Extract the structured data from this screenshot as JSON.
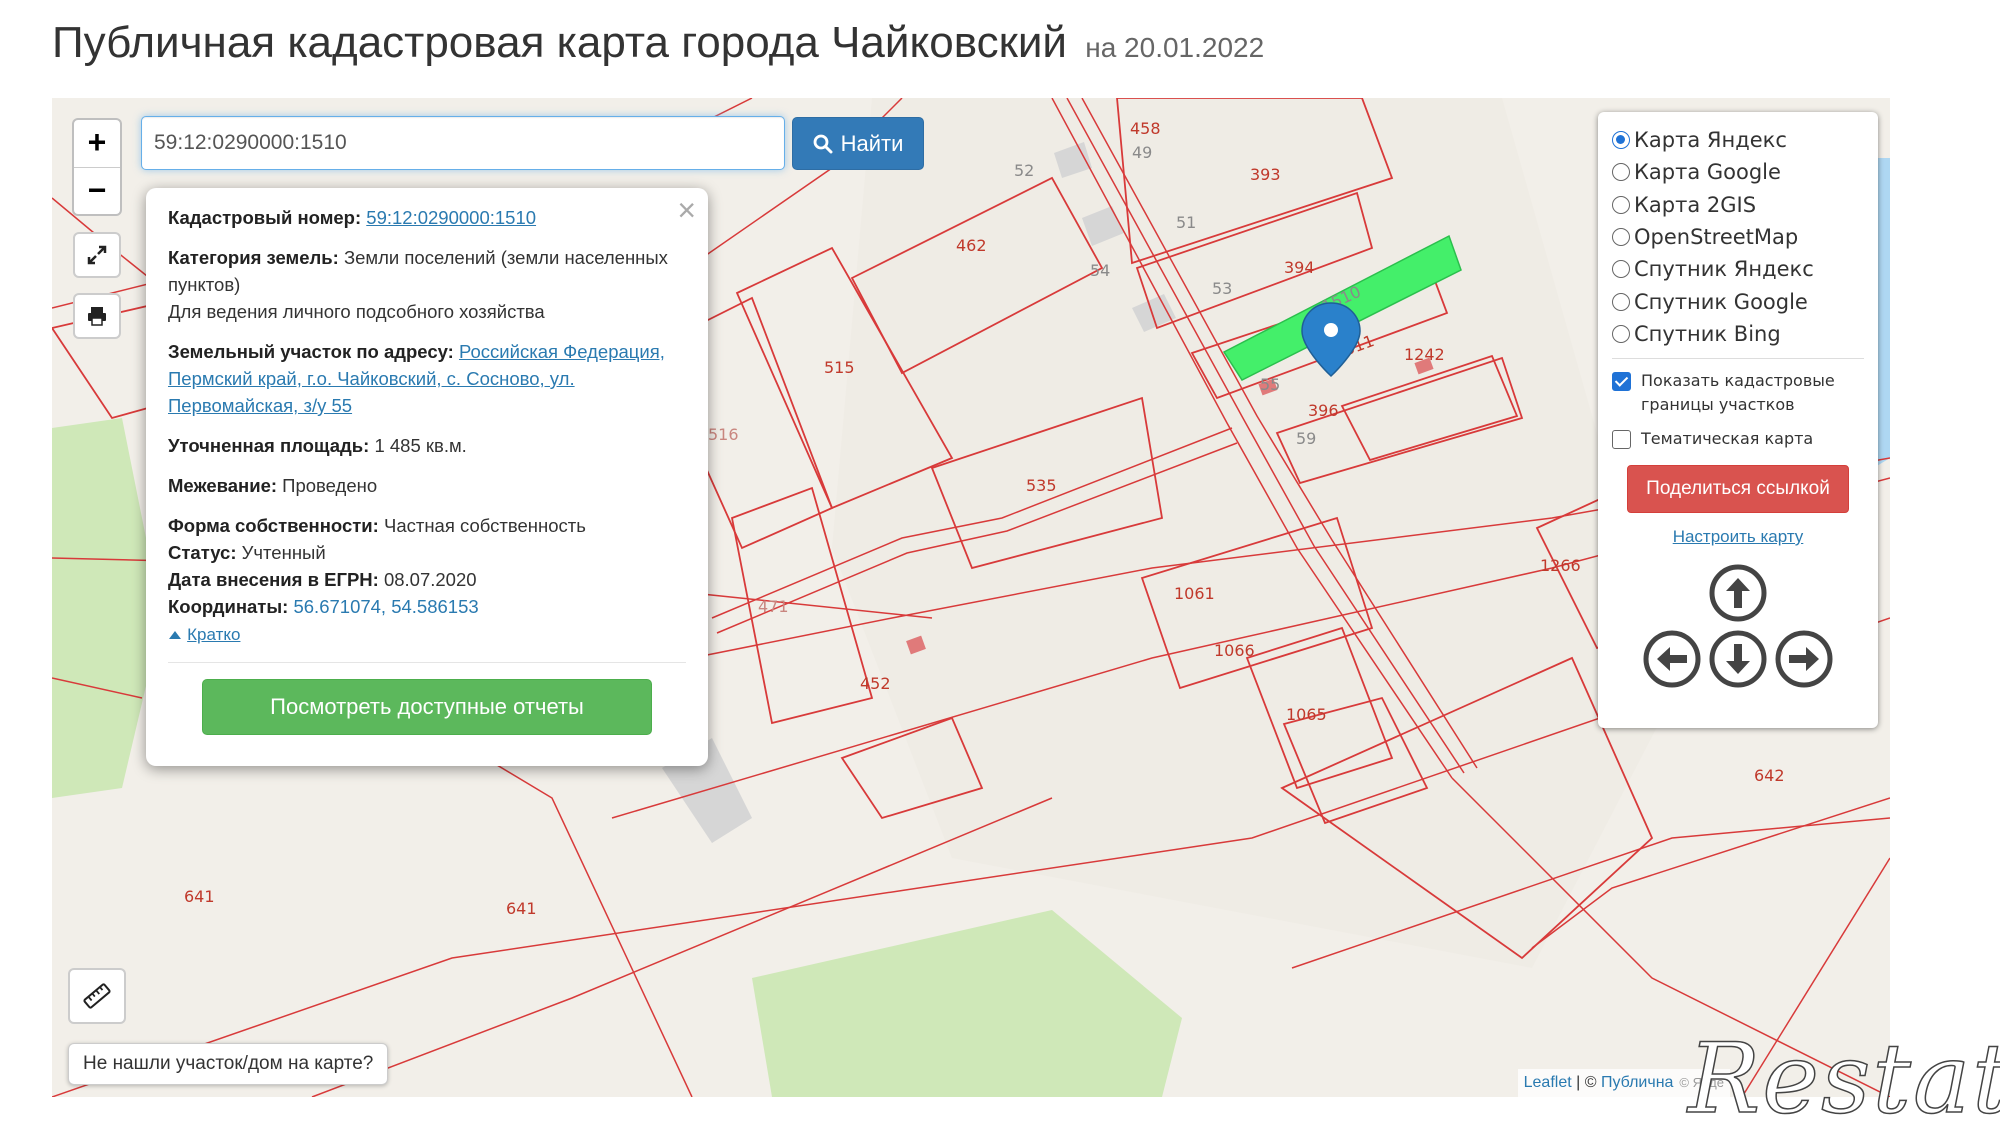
{
  "header": {
    "title": "Публичная кадастровая карта города Чайковский",
    "date": "на 20.01.2022"
  },
  "search": {
    "value": "59:12:0290000:1510",
    "button_label": "Найти"
  },
  "zoom": {
    "in_label": "+",
    "out_label": "−"
  },
  "popup": {
    "cadastral_label": "Кадастровый номер:",
    "cadastral_value": "59:12:0290000:1510",
    "category_label": "Категория земель:",
    "category_value": "Земли поселений (земли населенных пунктов)",
    "usage": "Для ведения личного подсобного хозяйства",
    "address_label": "Земельный участок по адресу:",
    "address_value": "Российская Федерация, Пермский край, г.о. Чайковский, с. Сосново, ул. Первомайская, з/у 55",
    "area_label": "Уточненная площадь:",
    "area_value": "1 485 кв.м.",
    "survey_label": "Межевание:",
    "survey_value": "Проведено",
    "ownership_label": "Форма собственности:",
    "ownership_value": "Частная собственность",
    "status_label": "Статус:",
    "status_value": "Учтенный",
    "egrn_label": "Дата внесения в ЕГРН:",
    "egrn_value": "08.07.2020",
    "coords_label": "Координаты:",
    "coords_value": "56.671074, 54.586153",
    "brief_link": "Кратко",
    "report_button": "Посмотреть доступные отчеты"
  },
  "layers": {
    "options": [
      {
        "label": "Карта Яндекс",
        "selected": true
      },
      {
        "label": "Карта Google",
        "selected": false
      },
      {
        "label": "Карта 2GIS",
        "selected": false
      },
      {
        "label": "OpenStreetMap",
        "selected": false
      },
      {
        "label": "Спутник Яндекс",
        "selected": false
      },
      {
        "label": "Спутник Google",
        "selected": false
      },
      {
        "label": "Спутник Bing",
        "selected": false
      }
    ],
    "show_borders_label": "Показать кадастровые границы участков",
    "show_borders_checked": true,
    "thematic_label": "Тематическая карта",
    "thematic_checked": false,
    "share_button": "Поделиться ссылкой",
    "configure_link": "Настроить карту"
  },
  "nav": {
    "up_icon": "arrow-up-circle-icon",
    "down_icon": "arrow-down-circle-icon",
    "left_icon": "arrow-left-circle-icon",
    "right_icon": "arrow-right-circle-icon"
  },
  "map": {
    "parcel_labels": [
      "458",
      "49",
      "393",
      "52",
      "51",
      "462",
      "394",
      "54",
      "53",
      "1510",
      "1511",
      "1242",
      "515",
      "55",
      "396",
      "59",
      "516",
      "535",
      "1266",
      "1061",
      "471",
      "1066",
      "452",
      "1065",
      "642",
      "641",
      "641"
    ],
    "highlight_color": "#44ef6a",
    "boundary_color": "#d83a3a",
    "marker_color": "#2a81cb"
  },
  "bottom": {
    "not_found_label": "Не нашли участок/дом на карте?",
    "attribution_leaflet": "Leaflet",
    "attribution_sep": " | © ",
    "attribution_public": "Публична",
    "attribution_yandex": "© Янде"
  },
  "watermark_text": "Restate"
}
